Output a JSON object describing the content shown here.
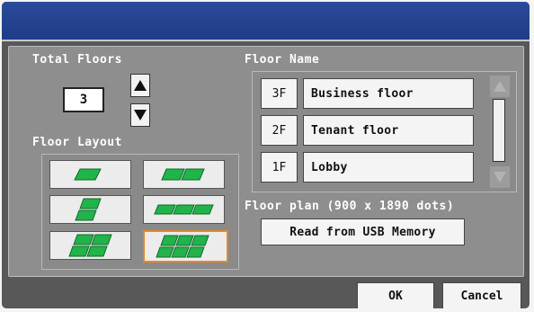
{
  "title": "",
  "total_floors": {
    "label": "Total Floors",
    "value": "3",
    "up_icon": "triangle-up-icon",
    "down_icon": "triangle-down-icon"
  },
  "floor_layout": {
    "label": "Floor Layout",
    "options": [
      {
        "id": "1",
        "icon": "one-floor-icon",
        "selected": false
      },
      {
        "id": "2-horizontal",
        "icon": "two-floors-horizontal-icon",
        "selected": false
      },
      {
        "id": "2-stacked",
        "icon": "two-floors-stacked-icon",
        "selected": false
      },
      {
        "id": "3-horizontal",
        "icon": "three-floors-horizontal-icon",
        "selected": false
      },
      {
        "id": "2x2",
        "icon": "four-floors-grid-icon",
        "selected": false
      },
      {
        "id": "3x2",
        "icon": "six-floors-grid-icon",
        "selected": true
      }
    ],
    "selected_color": "#e08a2a",
    "floor_color": "#22b34a"
  },
  "floor_name": {
    "label": "Floor Name",
    "rows": [
      {
        "floor": "3F",
        "name": "Business floor"
      },
      {
        "floor": "2F",
        "name": "Tenant floor"
      },
      {
        "floor": "1F",
        "name": "Lobby"
      }
    ]
  },
  "floor_plan": {
    "label": "Floor plan (900 x 1890 dots)",
    "button": "Read from USB Memory"
  },
  "footer": {
    "ok": "OK",
    "cancel": "Cancel"
  }
}
